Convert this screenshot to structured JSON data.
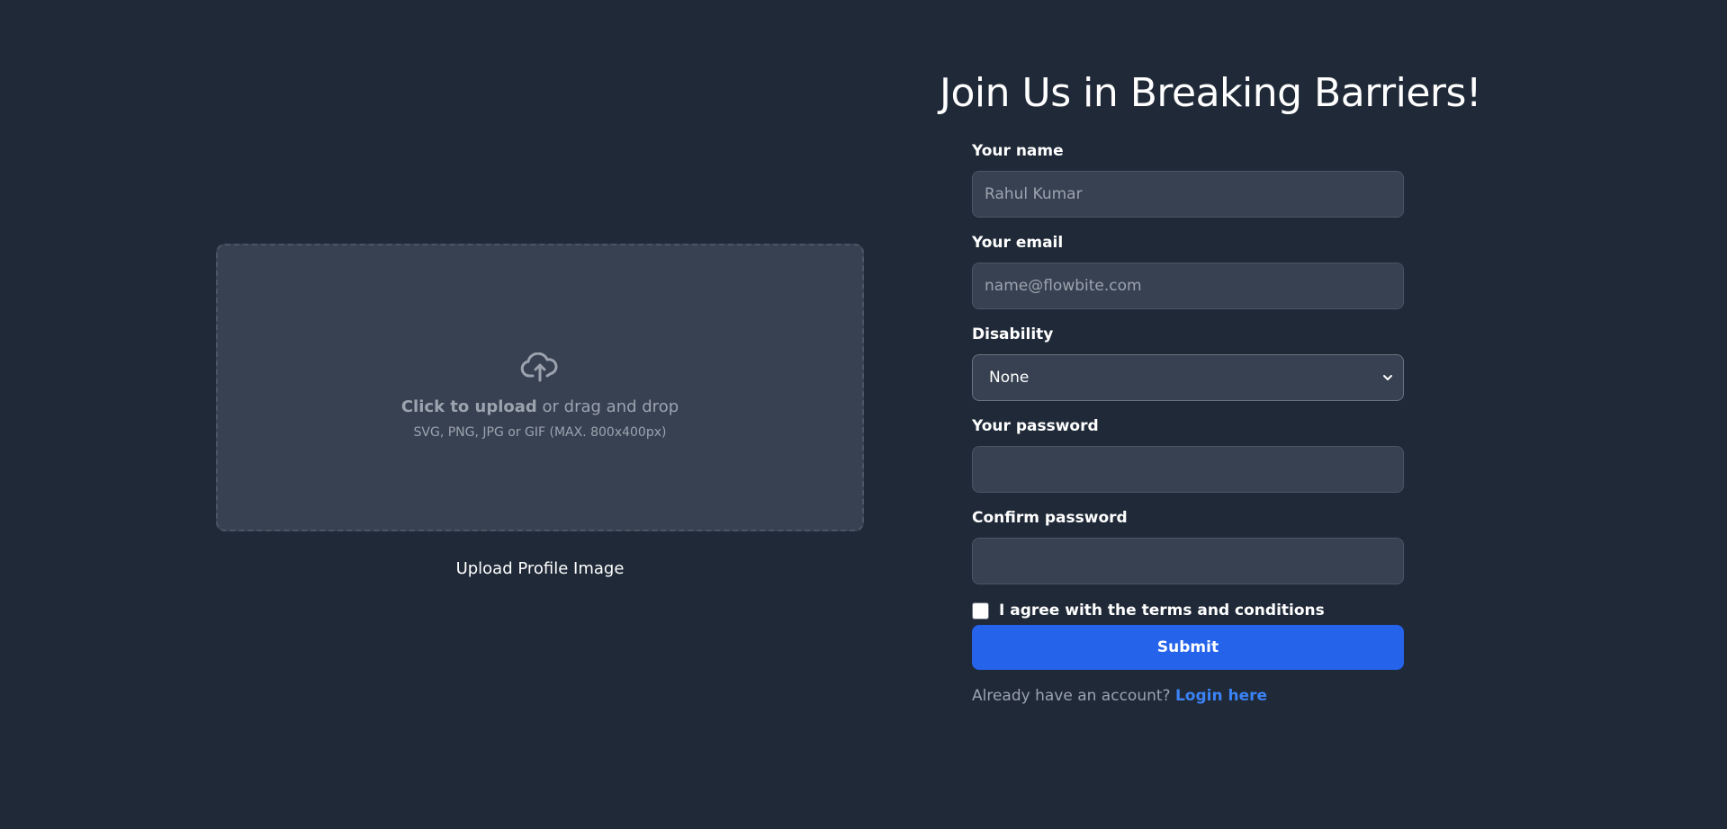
{
  "upload": {
    "icon": "cloud-upload-icon",
    "click_text": "Click to upload",
    "rest_text": " or drag and drop",
    "formats": "SVG, PNG, JPG or GIF (MAX. 800x400px)",
    "caption": "Upload Profile Image"
  },
  "form": {
    "title": "Join Us in Breaking Barriers!",
    "name": {
      "label": "Your name",
      "placeholder": "Rahul Kumar",
      "value": ""
    },
    "email": {
      "label": "Your email",
      "placeholder": "name@flowbite.com",
      "value": ""
    },
    "disability": {
      "label": "Disability",
      "selected": "None",
      "icon": "chevron-down-icon"
    },
    "password": {
      "label": "Your password",
      "value": ""
    },
    "confirm_password": {
      "label": "Confirm password",
      "value": ""
    },
    "agree": {
      "label": "I agree with the terms and conditions",
      "checked": false
    },
    "submit_label": "Submit",
    "login_prompt": "Already have an account? ",
    "login_link": "Login here"
  },
  "colors": {
    "background": "#1f2937",
    "input_bg": "#374151",
    "accent": "#2563eb",
    "link": "#3b82f6",
    "muted_text": "#9ca3af"
  }
}
